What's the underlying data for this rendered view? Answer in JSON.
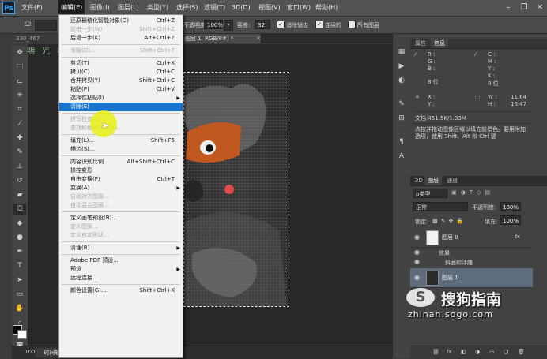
{
  "menubar": {
    "logo": "Ps",
    "items": [
      "文件(F)",
      "编辑(E)",
      "图像(I)",
      "图层(L)",
      "类型(Y)",
      "选择(S)",
      "滤镜(T)",
      "3D(D)",
      "视图(V)",
      "窗口(W)",
      "帮助(H)"
    ],
    "active_item": "编辑(E)",
    "window_buttons": [
      "–",
      "❐",
      "✕"
    ]
  },
  "options": {
    "mode_label": "模式:",
    "opacity_label": "不透明度:",
    "opacity_value": "100%",
    "tolerance_label": "容差:",
    "tolerance_value": "32",
    "antialias_label": "消除锯齿",
    "antialias_checked": true,
    "contiguous_label": "连续的",
    "contiguous_checked": true,
    "all_layers_label": "所有图层",
    "all_layers_checked": false
  },
  "tabs": {
    "doc_tab_left": "330_467",
    "doc_tab_right": "图层 1, RGB/8#) *",
    "doc_tab_close": "✕"
  },
  "canvas": {
    "chinese_watermark": "明 光 稻 乾"
  },
  "statusbar": {
    "zoom": "100%",
    "label": "时间轴"
  },
  "menu": {
    "items": [
      {
        "label": "还原栅格化智能对象(O)",
        "shortcut": "Ctrl+Z"
      },
      {
        "label": "前进一步(W)",
        "shortcut": "Shift+Ctrl+Z",
        "disabled": true
      },
      {
        "label": "后退一步(K)",
        "shortcut": "Alt+Ctrl+Z"
      },
      {
        "sep": true
      },
      {
        "label": "渐隐(D)...",
        "shortcut": "Shift+Ctrl+F",
        "disabled": true
      },
      {
        "sep": true
      },
      {
        "label": "剪切(T)",
        "shortcut": "Ctrl+X"
      },
      {
        "label": "拷贝(C)",
        "shortcut": "Ctrl+C"
      },
      {
        "label": "合并拷贝(Y)",
        "shortcut": "Shift+Ctrl+C"
      },
      {
        "label": "粘贴(P)",
        "shortcut": "Ctrl+V"
      },
      {
        "label": "选择性粘贴(I)",
        "submenu": true
      },
      {
        "label": "清除(E)",
        "highlight": true
      },
      {
        "sep": true
      },
      {
        "label": "拼写检查(H)...",
        "disabled": true
      },
      {
        "label": "查找和替换文本(X)...",
        "disabled": true
      },
      {
        "sep": true
      },
      {
        "label": "填充(L)...",
        "shortcut": "Shift+F5"
      },
      {
        "label": "描边(S)..."
      },
      {
        "sep": true
      },
      {
        "label": "内容识别比例",
        "shortcut": "Alt+Shift+Ctrl+C"
      },
      {
        "label": "操控变形"
      },
      {
        "label": "自由变换(F)",
        "shortcut": "Ctrl+T"
      },
      {
        "label": "变换(A)",
        "submenu": true
      },
      {
        "label": "自动对齐图层...",
        "disabled": true
      },
      {
        "label": "自动混合图层...",
        "disabled": true
      },
      {
        "sep": true
      },
      {
        "label": "定义画笔预设(B)..."
      },
      {
        "label": "定义图案...",
        "disabled": true
      },
      {
        "label": "定义自定形状...",
        "disabled": true
      },
      {
        "sep": true
      },
      {
        "label": "清理(R)",
        "submenu": true
      },
      {
        "sep": true
      },
      {
        "label": "Adobe PDF 预设..."
      },
      {
        "label": "预设",
        "submenu": true
      },
      {
        "label": "远程连接..."
      },
      {
        "sep": true
      },
      {
        "label": "颜色设置(G)...",
        "shortcut": "Shift+Ctrl+K"
      }
    ]
  },
  "info_panel": {
    "tabs": [
      "属性",
      "信息"
    ],
    "active_tab": "信息",
    "rgb": [
      "R :",
      "G :",
      "B :"
    ],
    "cmyk": [
      "C :",
      "M :",
      "Y :",
      "K :"
    ],
    "bits_left": "8 位",
    "bits_right": "8 位",
    "x_label": "X :",
    "y_label": "Y :",
    "w_label": "W :",
    "h_label": "H :",
    "w_value": "11.64",
    "h_value": "16.47",
    "doc_size": "文档:451.5K/1.03M",
    "hint": "点按并拖动图像区域以填充前景色。要用附加选项，使用 Shift、Alt 和 Ctrl 键"
  },
  "layers_panel": {
    "tabs": [
      "3D",
      "图层",
      "通道"
    ],
    "active_tab": "图层",
    "kind_filter": "ρ类型",
    "blend_mode": "正常",
    "opacity_label": "不透明度:",
    "opacity_value": "100%",
    "lock_label": "锁定:",
    "fill_label": "填充:",
    "fill_value": "100%",
    "layers": [
      {
        "name": "图层 0",
        "fx": "fx"
      },
      {
        "name": "效果",
        "sub": true
      },
      {
        "name": "斜面和浮雕",
        "sub": true,
        "deep": true
      },
      {
        "name": "图层 1",
        "selected": true
      }
    ],
    "bottom_icons": [
      "⛓",
      "fx",
      "◧",
      "◑",
      "▭",
      "❏",
      "🗑"
    ]
  },
  "watermark": {
    "brand": "搜狗指南",
    "url": "zhinan.sogo.com"
  }
}
